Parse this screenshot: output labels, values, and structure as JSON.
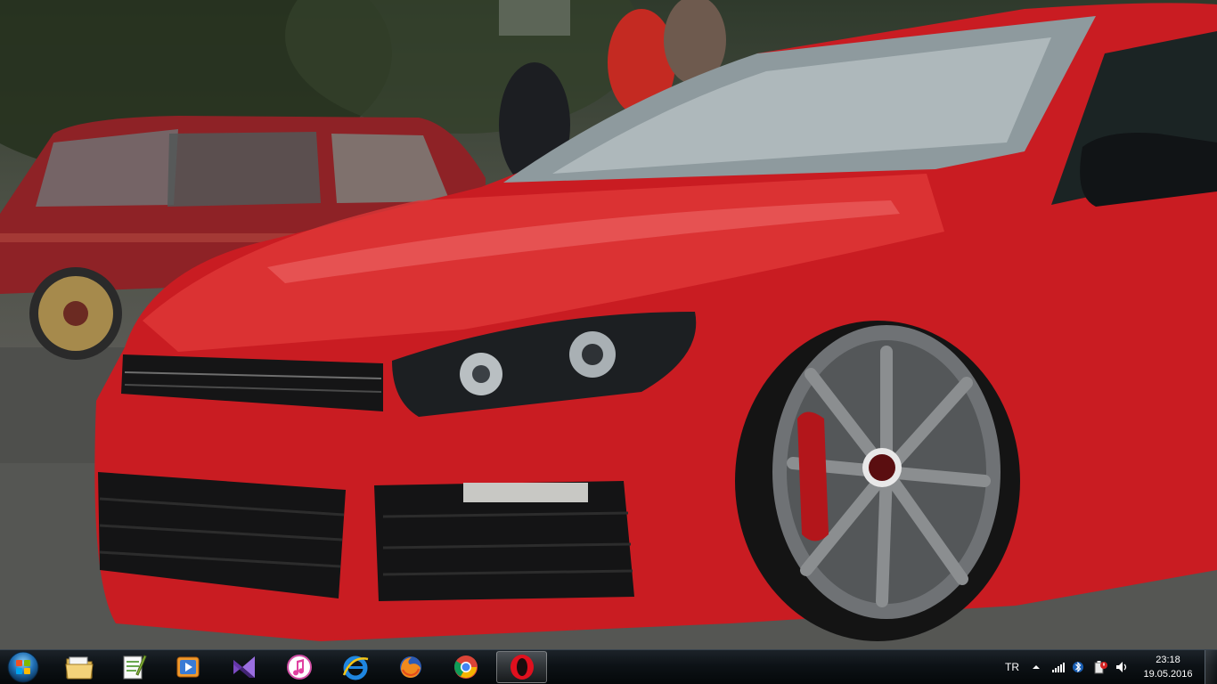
{
  "desktop": {
    "wallpaper": "red-car-wallpaper",
    "accent_colors": {
      "car_red": "#d81f24",
      "taskbar": "#0d1216"
    }
  },
  "taskbar": {
    "start_icon": "windows-start-orb-icon",
    "pinned": [
      {
        "icon": "file-explorer-icon"
      },
      {
        "icon": "notepad-plus-plus-icon"
      },
      {
        "icon": "media-player-icon"
      },
      {
        "icon": "visual-studio-icon"
      },
      {
        "icon": "itunes-icon"
      },
      {
        "icon": "internet-explorer-icon"
      },
      {
        "icon": "firefox-icon"
      },
      {
        "icon": "chrome-icon"
      },
      {
        "icon": "opera-icon",
        "active": true
      }
    ],
    "tray": {
      "language": "TR",
      "icons": [
        "show-hidden-icons-icon",
        "network-signal-icon",
        "bluetooth-icon",
        "power-icon",
        "volume-icon"
      ]
    },
    "clock": {
      "time": "23:18",
      "date": "19.05.2016"
    }
  }
}
